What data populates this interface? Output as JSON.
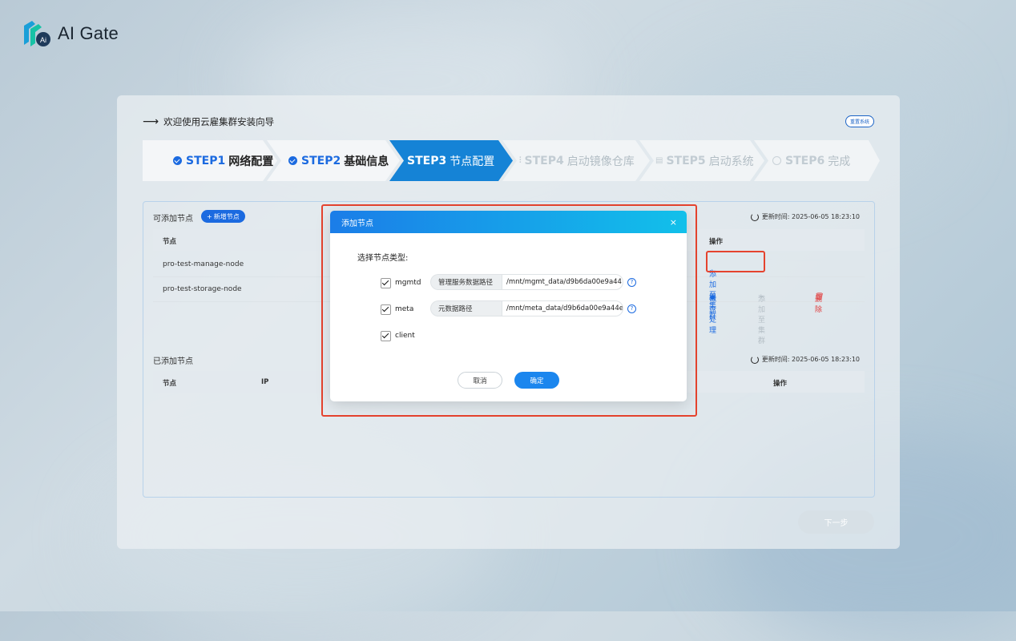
{
  "brand": {
    "name": "AI Gate"
  },
  "header": {
    "welcome": "欢迎使用云雇集群安装向导",
    "reset_label": "重置系统"
  },
  "steps": [
    {
      "num": "STEP1",
      "label": "网络配置",
      "status": "done"
    },
    {
      "num": "STEP2",
      "label": "基础信息",
      "status": "done"
    },
    {
      "num": "STEP3",
      "label": "节点配置",
      "status": "active"
    },
    {
      "num": "STEP4",
      "label": "启动镜像仓库",
      "status": "todo"
    },
    {
      "num": "STEP5",
      "label": "启动系统",
      "status": "todo"
    },
    {
      "num": "STEP6",
      "label": "完成",
      "status": "todo"
    }
  ],
  "available": {
    "title": "可添加节点",
    "add_button": "新增节点",
    "updated": "更新时间: 2025-06-05 18:23:10",
    "columns": {
      "node": "节点",
      "action": "操作"
    },
    "rows": [
      {
        "node": "pro-test-manage-node",
        "action": "添加至集群"
      },
      {
        "node": "pro-test-storage-node",
        "disk": "磁盘处理",
        "add": "添加至集群",
        "delete": "删除"
      }
    ]
  },
  "added": {
    "title": "已添加节点",
    "updated": "更新时间: 2025-06-05 18:23:10",
    "columns": {
      "node": "节点",
      "ip": "IP",
      "action": "操作"
    }
  },
  "next_label": "下一步",
  "modal": {
    "title": "添加节点",
    "close": "×",
    "prompt": "选择节点类型:",
    "options": [
      {
        "name": "mgmtd",
        "checked": true,
        "path_label": "管理服务数据路径",
        "path_value": "/mnt/mgmt_data/d9b6da00e9a44"
      },
      {
        "name": "meta",
        "checked": true,
        "path_label": "元数据路径",
        "path_value": "/mnt/meta_data/d9b6da00e9a44e"
      },
      {
        "name": "client",
        "checked": true
      }
    ],
    "cancel": "取消",
    "confirm": "确定"
  },
  "colors": {
    "primary": "#1b6ae0",
    "highlight": "#e5432e",
    "danger": "#e03c3c"
  }
}
